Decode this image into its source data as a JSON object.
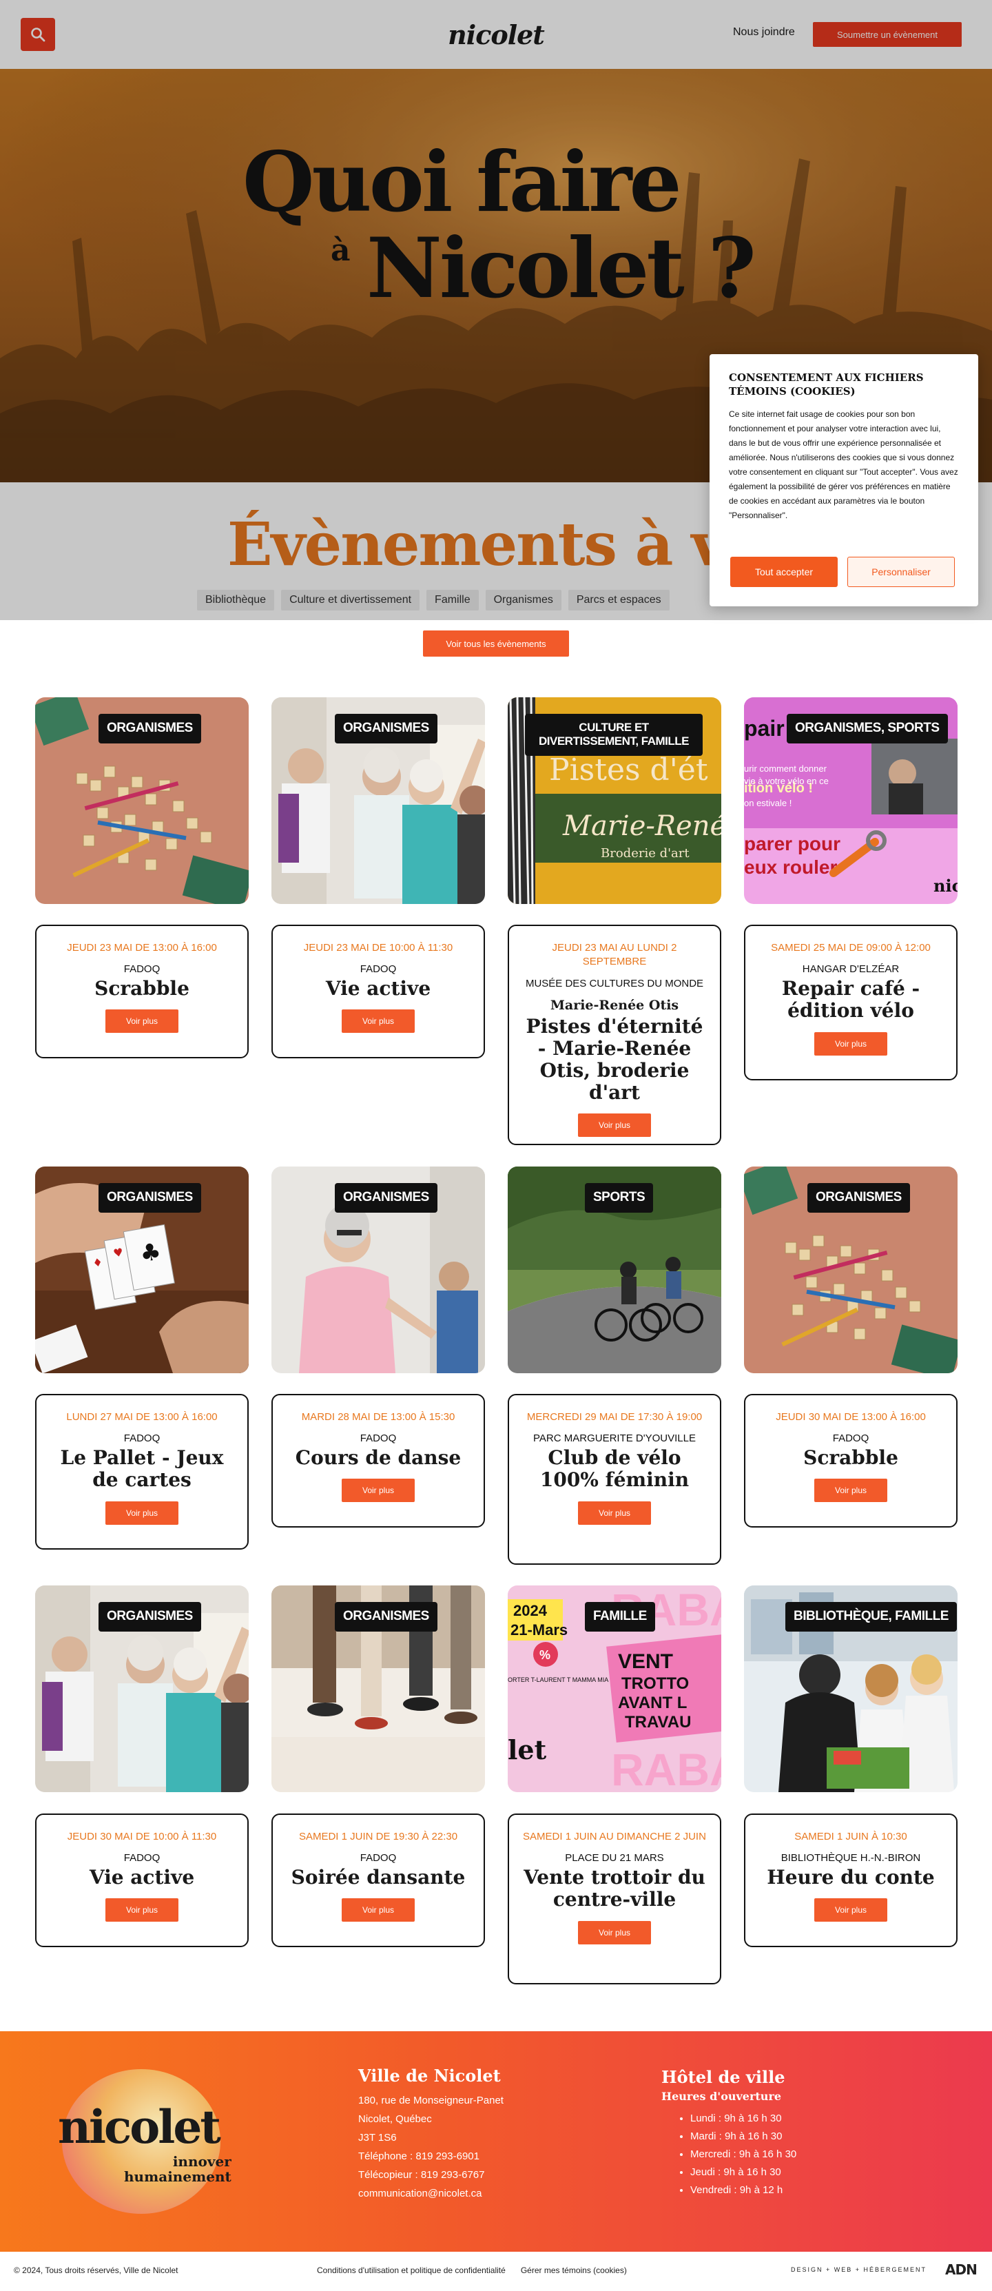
{
  "header": {
    "logo": "nicolet",
    "join_label": "Nous joindre",
    "submit_label": "Soumettre un évènement"
  },
  "hero": {
    "line1": "Quoi faire",
    "a": "à",
    "line2": "Nicolet ?"
  },
  "upcoming": {
    "title": "Évènements à venir",
    "filters": [
      "Bibliothèque",
      "Culture et divertissement",
      "Famille",
      "Organismes",
      "Parcs et espaces"
    ],
    "view_all_label": "Voir tous les évènements"
  },
  "cookie": {
    "title": "Consentement aux fichiers témoins (cookies)",
    "body": "Ce site internet fait usage de cookies pour son bon fonctionnement et pour analyser votre interaction avec lui, dans le but de vous offrir une expérience personnalisée et améliorée. Nous n'utiliserons des cookies que si vous donnez votre consentement en cliquant sur \"Tout accepter\". Vous avez également la possibilité de gérer vos préférences en matière de cookies en accédant aux paramètres via le bouton \"Personnaliser\".",
    "accept_label": "Tout accepter",
    "customize_label": "Personnaliser"
  },
  "events": [
    {
      "tag": "Organismes",
      "date": "Jeudi 23 mai de 13:00 à 16:00",
      "org": "FADOQ",
      "sub": "",
      "title": "Scrabble",
      "button": "Voir plus"
    },
    {
      "tag": "Organismes",
      "date": "Jeudi 23 mai de 10:00 à 11:30",
      "org": "FADOQ",
      "sub": "",
      "title": "Vie active",
      "button": "Voir plus"
    },
    {
      "tag": "Culture et divertissement, Famille",
      "date": "Jeudi 23 mai au lundi 2 septembre",
      "org": "Musée des cultures du monde",
      "sub": "Marie-Renée Otis",
      "title": "Pistes d'éternité - Marie-Renée Otis, broderie d'art",
      "button": "Voir plus"
    },
    {
      "tag": "Organismes, Sports",
      "date": "Samedi 25 mai de 09:00 à 12:00",
      "org": "Hangar d'Elzéar",
      "sub": "",
      "title": "Repair café - édition vélo",
      "button": "Voir plus"
    },
    {
      "tag": "Organismes",
      "date": "Lundi 27 mai de 13:00 à 16:00",
      "org": "FADOQ",
      "sub": "",
      "title": "Le Pallet - Jeux de cartes",
      "button": "Voir plus"
    },
    {
      "tag": "Organismes",
      "date": "Mardi 28 mai de 13:00 à 15:30",
      "org": "FADOQ",
      "sub": "",
      "title": "Cours de danse",
      "button": "Voir plus"
    },
    {
      "tag": "Sports",
      "date": "Mercredi 29 mai de 17:30 à 19:00",
      "org": "Parc Marguerite D'Youville",
      "sub": "",
      "title": "Club de vélo 100% féminin",
      "button": "Voir plus"
    },
    {
      "tag": "Organismes",
      "date": "Jeudi 30 mai de 13:00 à 16:00",
      "org": "FADOQ",
      "sub": "",
      "title": "Scrabble",
      "button": "Voir plus"
    },
    {
      "tag": "Organismes",
      "date": "Jeudi 30 mai de 10:00 à 11:30",
      "org": "FADOQ",
      "sub": "",
      "title": "Vie active",
      "button": "Voir plus"
    },
    {
      "tag": "Organismes",
      "date": "Samedi 1 juin de 19:30 à 22:30",
      "org": "FADOQ",
      "sub": "",
      "title": "Soirée dansante",
      "button": "Voir plus"
    },
    {
      "tag": "Famille",
      "date": "Samedi 1 juin au dimanche 2 juin",
      "org": "Place du 21 mars",
      "sub": "",
      "title": "Vente trottoir du centre-ville",
      "button": "Voir plus"
    },
    {
      "tag": "Bibliothèque, Famille",
      "date": "Samedi 1 juin à 10:30",
      "org": "Bibliothèque H.-N.-Biron",
      "sub": "",
      "title": "Heure du conte",
      "button": "Voir plus"
    }
  ],
  "images": {
    "pistes_poster": "Pistes d'ét",
    "pistes_script": "Marie-René",
    "pistes_sub": "Broderie d'art",
    "repair_poster_1": "pair",
    "repair_poster_2": "ition vélo !",
    "repair_poster_3": "urir comment donner",
    "repair_poster_4": "vie à votre vélo en ce",
    "repair_poster_5": "on estivale !",
    "repair_poster_6": "parer pour",
    "repair_poster_7": "eux rouler",
    "repair_poster_8": "nic",
    "vente_year": "2024",
    "vente_date": "21-Mars",
    "vente_big": "RABA",
    "vente_words": "VENT TROTTO AVANT L TRAVAU",
    "vente_small": "ORTER T-LAURENT T MAMMA MIA",
    "vente_logo": "let",
    "vente_percent": "%"
  },
  "footer": {
    "logo": "nicolet",
    "logo_sub1": "innover",
    "logo_sub2": "humainement",
    "city_title": "Ville de Nicolet",
    "address1": "180, rue de Monseigneur-Panet",
    "address2": "Nicolet, Québec",
    "postal": "J3T 1S6",
    "phone": "Téléphone : 819 293-6901",
    "fax": "Télécopieur : 819 293-6767",
    "email": "communication@nicolet.ca",
    "hall_title": "Hôtel de ville",
    "hours_title": "Heures d'ouverture",
    "hours": [
      "Lundi : 9h à 16 h 30",
      "Mardi : 9h à 16 h 30",
      "Mercredi : 9h à 16 h 30",
      "Jeudi : 9h à 16 h 30",
      "Vendredi : 9h à 12 h"
    ]
  },
  "bottom": {
    "copyright": "© 2024, Tous droits réservés, Ville de Nicolet",
    "terms": "Conditions d'utilisation et politique de confidentialité",
    "cookies": "Gérer mes témoins (cookies)",
    "design": "DESIGN + WEB + HÉBERGEMENT",
    "agency": "ADN"
  },
  "colors": {
    "accent": "#f25a2a",
    "date_orange": "#e8781f",
    "footer_start": "#f7781c",
    "footer_end": "#ec3a4e"
  }
}
